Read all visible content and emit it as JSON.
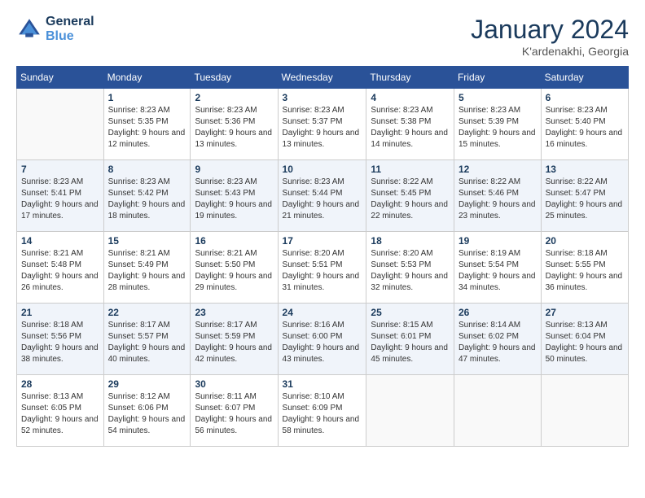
{
  "header": {
    "logo_line1": "General",
    "logo_line2": "Blue",
    "month_title": "January 2024",
    "location": "K'ardenakhi, Georgia"
  },
  "days_of_week": [
    "Sunday",
    "Monday",
    "Tuesday",
    "Wednesday",
    "Thursday",
    "Friday",
    "Saturday"
  ],
  "weeks": [
    [
      {
        "day": "",
        "sunrise": "",
        "sunset": "",
        "daylight": ""
      },
      {
        "day": "1",
        "sunrise": "Sunrise: 8:23 AM",
        "sunset": "Sunset: 5:35 PM",
        "daylight": "Daylight: 9 hours and 12 minutes."
      },
      {
        "day": "2",
        "sunrise": "Sunrise: 8:23 AM",
        "sunset": "Sunset: 5:36 PM",
        "daylight": "Daylight: 9 hours and 13 minutes."
      },
      {
        "day": "3",
        "sunrise": "Sunrise: 8:23 AM",
        "sunset": "Sunset: 5:37 PM",
        "daylight": "Daylight: 9 hours and 13 minutes."
      },
      {
        "day": "4",
        "sunrise": "Sunrise: 8:23 AM",
        "sunset": "Sunset: 5:38 PM",
        "daylight": "Daylight: 9 hours and 14 minutes."
      },
      {
        "day": "5",
        "sunrise": "Sunrise: 8:23 AM",
        "sunset": "Sunset: 5:39 PM",
        "daylight": "Daylight: 9 hours and 15 minutes."
      },
      {
        "day": "6",
        "sunrise": "Sunrise: 8:23 AM",
        "sunset": "Sunset: 5:40 PM",
        "daylight": "Daylight: 9 hours and 16 minutes."
      }
    ],
    [
      {
        "day": "7",
        "sunrise": "Sunrise: 8:23 AM",
        "sunset": "Sunset: 5:41 PM",
        "daylight": "Daylight: 9 hours and 17 minutes."
      },
      {
        "day": "8",
        "sunrise": "Sunrise: 8:23 AM",
        "sunset": "Sunset: 5:42 PM",
        "daylight": "Daylight: 9 hours and 18 minutes."
      },
      {
        "day": "9",
        "sunrise": "Sunrise: 8:23 AM",
        "sunset": "Sunset: 5:43 PM",
        "daylight": "Daylight: 9 hours and 19 minutes."
      },
      {
        "day": "10",
        "sunrise": "Sunrise: 8:23 AM",
        "sunset": "Sunset: 5:44 PM",
        "daylight": "Daylight: 9 hours and 21 minutes."
      },
      {
        "day": "11",
        "sunrise": "Sunrise: 8:22 AM",
        "sunset": "Sunset: 5:45 PM",
        "daylight": "Daylight: 9 hours and 22 minutes."
      },
      {
        "day": "12",
        "sunrise": "Sunrise: 8:22 AM",
        "sunset": "Sunset: 5:46 PM",
        "daylight": "Daylight: 9 hours and 23 minutes."
      },
      {
        "day": "13",
        "sunrise": "Sunrise: 8:22 AM",
        "sunset": "Sunset: 5:47 PM",
        "daylight": "Daylight: 9 hours and 25 minutes."
      }
    ],
    [
      {
        "day": "14",
        "sunrise": "Sunrise: 8:21 AM",
        "sunset": "Sunset: 5:48 PM",
        "daylight": "Daylight: 9 hours and 26 minutes."
      },
      {
        "day": "15",
        "sunrise": "Sunrise: 8:21 AM",
        "sunset": "Sunset: 5:49 PM",
        "daylight": "Daylight: 9 hours and 28 minutes."
      },
      {
        "day": "16",
        "sunrise": "Sunrise: 8:21 AM",
        "sunset": "Sunset: 5:50 PM",
        "daylight": "Daylight: 9 hours and 29 minutes."
      },
      {
        "day": "17",
        "sunrise": "Sunrise: 8:20 AM",
        "sunset": "Sunset: 5:51 PM",
        "daylight": "Daylight: 9 hours and 31 minutes."
      },
      {
        "day": "18",
        "sunrise": "Sunrise: 8:20 AM",
        "sunset": "Sunset: 5:53 PM",
        "daylight": "Daylight: 9 hours and 32 minutes."
      },
      {
        "day": "19",
        "sunrise": "Sunrise: 8:19 AM",
        "sunset": "Sunset: 5:54 PM",
        "daylight": "Daylight: 9 hours and 34 minutes."
      },
      {
        "day": "20",
        "sunrise": "Sunrise: 8:18 AM",
        "sunset": "Sunset: 5:55 PM",
        "daylight": "Daylight: 9 hours and 36 minutes."
      }
    ],
    [
      {
        "day": "21",
        "sunrise": "Sunrise: 8:18 AM",
        "sunset": "Sunset: 5:56 PM",
        "daylight": "Daylight: 9 hours and 38 minutes."
      },
      {
        "day": "22",
        "sunrise": "Sunrise: 8:17 AM",
        "sunset": "Sunset: 5:57 PM",
        "daylight": "Daylight: 9 hours and 40 minutes."
      },
      {
        "day": "23",
        "sunrise": "Sunrise: 8:17 AM",
        "sunset": "Sunset: 5:59 PM",
        "daylight": "Daylight: 9 hours and 42 minutes."
      },
      {
        "day": "24",
        "sunrise": "Sunrise: 8:16 AM",
        "sunset": "Sunset: 6:00 PM",
        "daylight": "Daylight: 9 hours and 43 minutes."
      },
      {
        "day": "25",
        "sunrise": "Sunrise: 8:15 AM",
        "sunset": "Sunset: 6:01 PM",
        "daylight": "Daylight: 9 hours and 45 minutes."
      },
      {
        "day": "26",
        "sunrise": "Sunrise: 8:14 AM",
        "sunset": "Sunset: 6:02 PM",
        "daylight": "Daylight: 9 hours and 47 minutes."
      },
      {
        "day": "27",
        "sunrise": "Sunrise: 8:13 AM",
        "sunset": "Sunset: 6:04 PM",
        "daylight": "Daylight: 9 hours and 50 minutes."
      }
    ],
    [
      {
        "day": "28",
        "sunrise": "Sunrise: 8:13 AM",
        "sunset": "Sunset: 6:05 PM",
        "daylight": "Daylight: 9 hours and 52 minutes."
      },
      {
        "day": "29",
        "sunrise": "Sunrise: 8:12 AM",
        "sunset": "Sunset: 6:06 PM",
        "daylight": "Daylight: 9 hours and 54 minutes."
      },
      {
        "day": "30",
        "sunrise": "Sunrise: 8:11 AM",
        "sunset": "Sunset: 6:07 PM",
        "daylight": "Daylight: 9 hours and 56 minutes."
      },
      {
        "day": "31",
        "sunrise": "Sunrise: 8:10 AM",
        "sunset": "Sunset: 6:09 PM",
        "daylight": "Daylight: 9 hours and 58 minutes."
      },
      {
        "day": "",
        "sunrise": "",
        "sunset": "",
        "daylight": ""
      },
      {
        "day": "",
        "sunrise": "",
        "sunset": "",
        "daylight": ""
      },
      {
        "day": "",
        "sunrise": "",
        "sunset": "",
        "daylight": ""
      }
    ]
  ]
}
